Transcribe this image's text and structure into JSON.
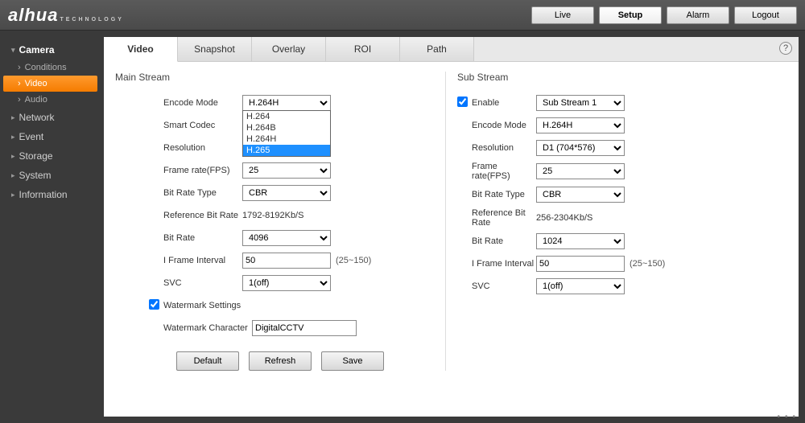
{
  "logo": {
    "text": "alhua",
    "sub": "TECHNOLOGY"
  },
  "topnav": {
    "live": "Live",
    "setup": "Setup",
    "alarm": "Alarm",
    "logout": "Logout"
  },
  "sidebar": {
    "camera": "Camera",
    "conditions": "Conditions",
    "video": "Video",
    "audio": "Audio",
    "network": "Network",
    "event": "Event",
    "storage": "Storage",
    "system": "System",
    "information": "Information"
  },
  "tabs": {
    "video": "Video",
    "snapshot": "Snapshot",
    "overlay": "Overlay",
    "roi": "ROI",
    "path": "Path"
  },
  "help": "?",
  "main": {
    "title": "Main Stream",
    "encode_mode_lbl": "Encode Mode",
    "encode_mode": "H.264H",
    "encode_opts": {
      "o1": "H.264",
      "o2": "H.264B",
      "o3": "H.264H",
      "o4": "H.265"
    },
    "smart_codec_lbl": "Smart Codec",
    "resolution_lbl": "Resolution",
    "fps_lbl": "Frame rate(FPS)",
    "fps": "25",
    "brtype_lbl": "Bit Rate Type",
    "brtype": "CBR",
    "refbr_lbl": "Reference Bit Rate",
    "refbr": "1792-8192Kb/S",
    "br_lbl": "Bit Rate",
    "br": "4096",
    "iframe_lbl": "I Frame Interval",
    "iframe": "50",
    "iframe_hint": "(25~150)",
    "svc_lbl": "SVC",
    "svc": "1(off)",
    "wm_lbl": "Watermark Settings",
    "wmchar_lbl": "Watermark Character",
    "wmchar": "DigitalCCTV"
  },
  "sub": {
    "title": "Sub Stream",
    "enable_lbl": "Enable",
    "enable_val": "Sub Stream 1",
    "encode_mode_lbl": "Encode Mode",
    "encode_mode": "H.264H",
    "resolution_lbl": "Resolution",
    "resolution": "D1 (704*576)",
    "fps_lbl": "Frame rate(FPS)",
    "fps": "25",
    "brtype_lbl": "Bit Rate Type",
    "brtype": "CBR",
    "refbr_lbl": "Reference Bit Rate",
    "refbr": "256-2304Kb/S",
    "br_lbl": "Bit Rate",
    "br": "1024",
    "iframe_lbl": "I Frame Interval",
    "iframe": "50",
    "iframe_hint": "(25~150)",
    "svc_lbl": "SVC",
    "svc": "1(off)"
  },
  "buttons": {
    "default": "Default",
    "refresh": "Refresh",
    "save": "Save"
  }
}
